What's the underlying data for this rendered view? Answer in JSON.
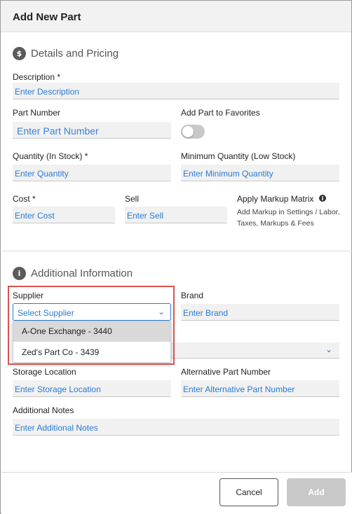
{
  "header": {
    "title": "Add New Part"
  },
  "details": {
    "section_title": "Details and Pricing",
    "icon": "$",
    "description": {
      "label": "Description *",
      "placeholder": "Enter Description"
    },
    "part_number": {
      "label": "Part Number",
      "placeholder": "Enter Part Number"
    },
    "favorites": {
      "label": "Add Part to Favorites",
      "enabled": false
    },
    "quantity": {
      "label": "Quantity (In Stock) *",
      "placeholder": "Enter Quantity"
    },
    "min_quantity": {
      "label": "Minimum Quantity (Low Stock)",
      "placeholder": "Enter Minimum Quantity"
    },
    "cost": {
      "label": "Cost *",
      "placeholder": "Enter Cost"
    },
    "sell": {
      "label": "Sell",
      "placeholder": "Enter Sell"
    },
    "markup": {
      "label": "Apply Markup Matrix",
      "hint_line1": "Add Markup in Settings / Labor,",
      "hint_line2": "Taxes, Markups & Fees"
    }
  },
  "additional": {
    "section_title": "Additional Information",
    "icon": "i",
    "supplier": {
      "label": "Supplier",
      "placeholder": "Select Supplier",
      "options": [
        "A-One Exchange - 3440",
        "Zed's Part Co - 3439"
      ]
    },
    "brand": {
      "label": "Brand",
      "placeholder": "Enter Brand"
    },
    "storage": {
      "label": "Storage Location",
      "placeholder": "Enter Storage Location"
    },
    "alt_part": {
      "label": "Alternative Part Number",
      "placeholder": "Enter Alternative Part Number"
    },
    "notes": {
      "label": "Additional Notes",
      "placeholder": "Enter Additional Notes"
    }
  },
  "footer": {
    "cancel_label": "Cancel",
    "add_label": "Add"
  },
  "colors": {
    "accent": "#2a7bd4",
    "highlight": "#d9534f"
  }
}
